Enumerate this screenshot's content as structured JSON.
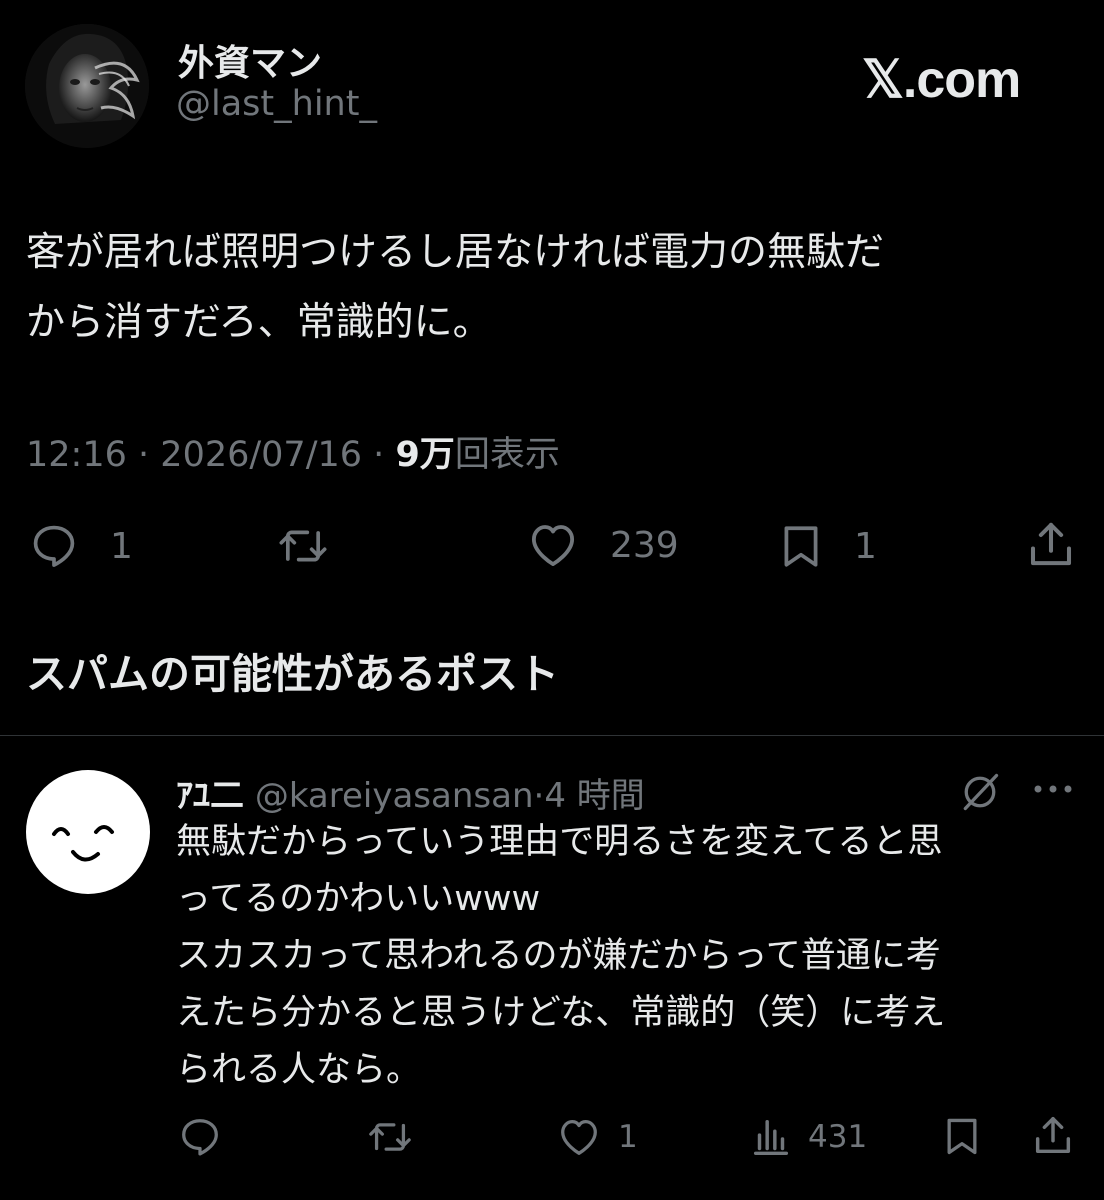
{
  "brand": "𝕏.com",
  "main_post": {
    "display_name": "外資マン",
    "handle": "@last_hint_",
    "text": "客が居れば照明つけるし居なければ電力の無駄だ\nから消すだろ、常識的に。",
    "time": "12:16",
    "date": "2026/07/16",
    "separator": "·",
    "views_count": "9万",
    "views_label": "回表示",
    "actions": {
      "replies": "1",
      "reposts": "",
      "likes": "239",
      "bookmarks": "1"
    }
  },
  "section_title": "スパムの可能性があるポスト",
  "reply_post": {
    "display_name": "ｱﾕ二",
    "handle": "@kareiyasansan",
    "time_ago": "4 時間",
    "text": "無駄だからっていう理由で明るさを変えてると思\nってるのかわいいwww\nスカスカって思われるのが嫌だからって普通に考\nえたら分かると思うけどな、常識的（笑）に考え\nられる人なら。",
    "actions": {
      "replies": "",
      "reposts": "",
      "likes": "1",
      "views": "431"
    }
  },
  "icons": {
    "reply": "speech-bubble-icon",
    "repost": "repost-arrows-icon",
    "like": "heart-icon",
    "bookmark": "bookmark-icon",
    "share": "share-upload-icon",
    "views": "bar-chart-icon",
    "grok": "grok-slash-icon",
    "more": "more-dots-icon"
  },
  "colors": {
    "background": "#000000",
    "text_primary": "#e7e9ea",
    "text_secondary": "#71767b",
    "divider": "#2f3336"
  }
}
